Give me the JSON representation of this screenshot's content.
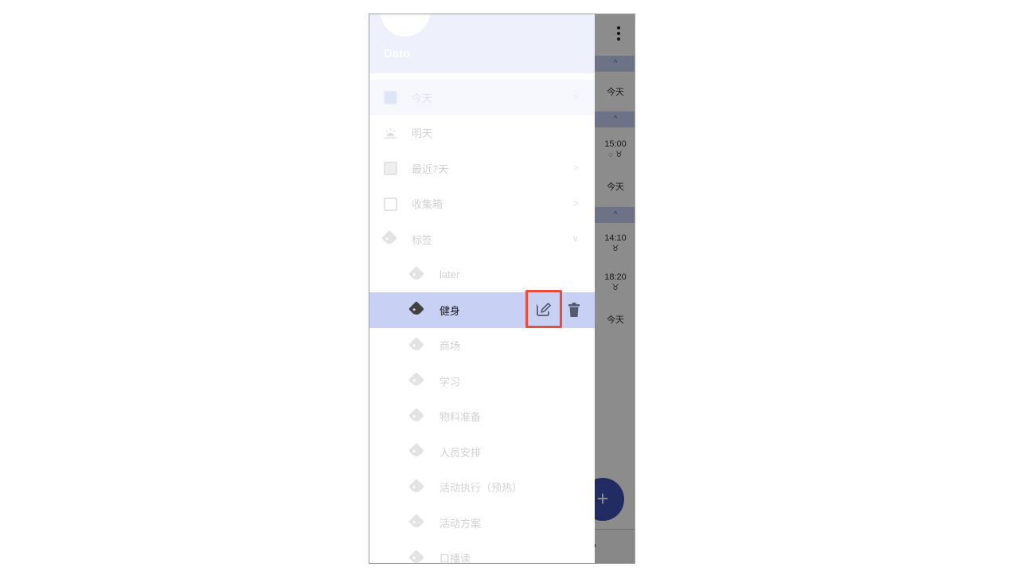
{
  "app": {
    "username": "Dato"
  },
  "background": {
    "sections": [
      "^",
      "^",
      "^"
    ],
    "entries": [
      {
        "text": "今天"
      },
      {
        "text": "15:00"
      },
      {
        "text": "今天"
      },
      {
        "text": "14:10"
      },
      {
        "text": "18:20"
      },
      {
        "text": "今天"
      }
    ],
    "fab_label": "+"
  },
  "drawer": {
    "items": [
      {
        "label": "今天",
        "icon": "calendar-today-icon",
        "chevron": ">"
      },
      {
        "label": "明天",
        "icon": "sunrise-icon"
      },
      {
        "label": "最近7天",
        "icon": "calendar-week-icon",
        "chevron": ">"
      },
      {
        "label": "收集箱",
        "icon": "inbox-icon",
        "chevron": ">"
      },
      {
        "label": "标签",
        "icon": "tags-icon",
        "chevron": "v"
      }
    ],
    "tags": [
      {
        "label": "later"
      },
      {
        "label": "健身",
        "selected": true
      },
      {
        "label": "商场"
      },
      {
        "label": "学习"
      },
      {
        "label": "物料准备"
      },
      {
        "label": "人员安排"
      },
      {
        "label": "活动执行（预热）"
      },
      {
        "label": "活动方案"
      },
      {
        "label": "口播读"
      }
    ]
  },
  "colors": {
    "accent": "#3f51b5",
    "selected_row": "#c8d0f4",
    "highlight_box": "#e74c3c"
  }
}
